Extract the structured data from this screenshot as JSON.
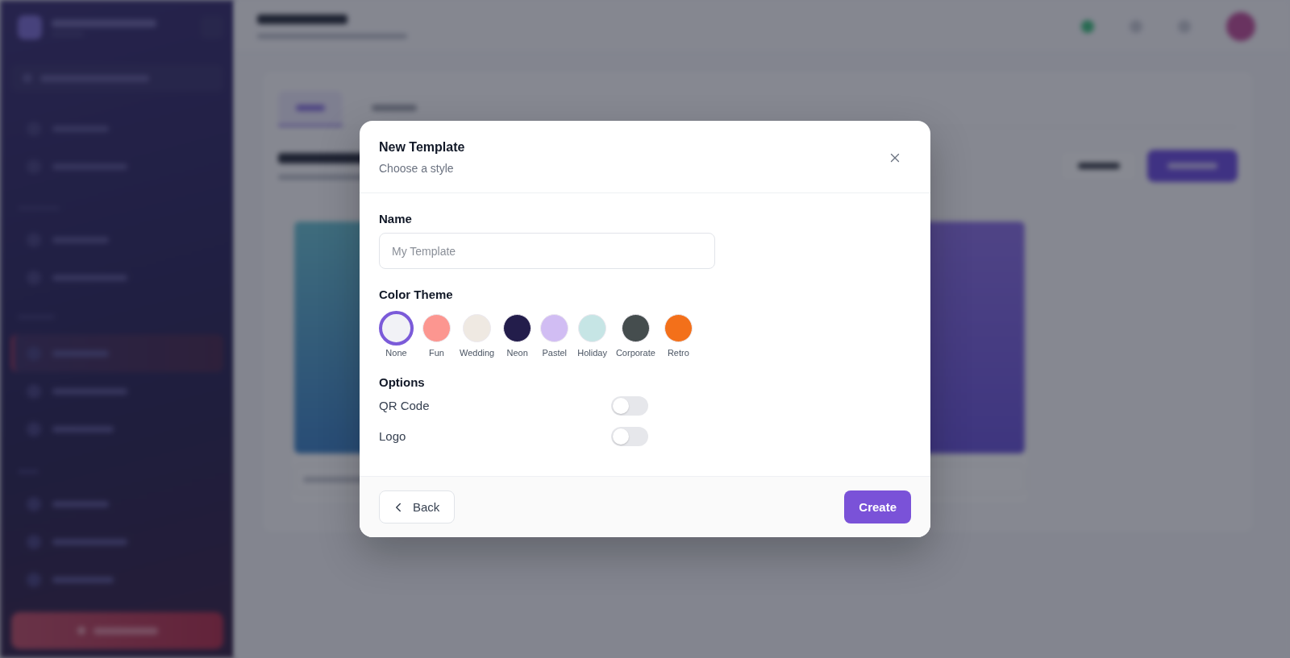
{
  "dialog": {
    "title": "New Template",
    "subtitle": "Choose a style",
    "name_field": {
      "label": "Name",
      "placeholder": "My Template"
    },
    "color_theme": {
      "label": "Color Theme",
      "themes": [
        {
          "label": "None",
          "color": "#f1f2f6",
          "selected": true
        },
        {
          "label": "Fun",
          "color": "#fc9690",
          "selected": false
        },
        {
          "label": "Wedding",
          "color": "#efe9e2",
          "selected": false
        },
        {
          "label": "Neon",
          "color": "#231d4b",
          "selected": false
        },
        {
          "label": "Pastel",
          "color": "#d1bdf3",
          "selected": false
        },
        {
          "label": "Holiday",
          "color": "#c6e5e5",
          "selected": false
        },
        {
          "label": "Corporate",
          "color": "#454d4e",
          "selected": false
        },
        {
          "label": "Retro",
          "color": "#f3701a",
          "selected": false
        }
      ]
    },
    "options": {
      "label": "Options",
      "items": [
        {
          "label": "QR Code",
          "on": false
        },
        {
          "label": "Logo",
          "on": false
        }
      ]
    },
    "back_button": {
      "label": "Back"
    },
    "create_button": {
      "label": "Create"
    }
  }
}
